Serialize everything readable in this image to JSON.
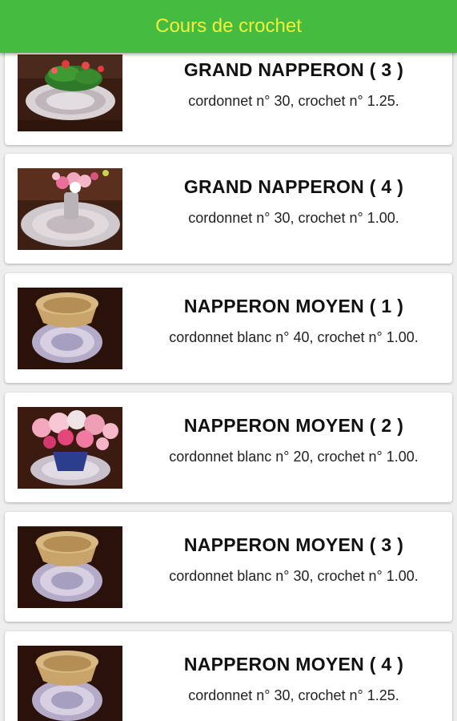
{
  "app_bar": {
    "title": "Cours de crochet",
    "background": "#45bc40",
    "title_color": "#f2ef3a"
  },
  "items": [
    {
      "title": "GRAND NAPPERON ( 3 )",
      "subtitle": "cordonnet n° 30, crochet n° 1.25.",
      "image": "doily-with-flowers-photo"
    },
    {
      "title": "GRAND NAPPERON ( 4 )",
      "subtitle": "cordonnet n° 30, crochet n° 1.00.",
      "image": "doily-with-vase-photo"
    },
    {
      "title": "NAPPERON MOYEN ( 1 )",
      "subtitle": "cordonnet blanc n° 40, crochet n° 1.00.",
      "image": "doily-with-wooden-bowl-photo"
    },
    {
      "title": "NAPPERON MOYEN ( 2 )",
      "subtitle": "cordonnet blanc n° 20, crochet n° 1.00.",
      "image": "doily-with-pink-flowers-photo"
    },
    {
      "title": "NAPPERON MOYEN ( 3 )",
      "subtitle": "cordonnet blanc n° 30, crochet n° 1.00.",
      "image": "doily-with-wooden-bowl-photo"
    },
    {
      "title": "NAPPERON MOYEN ( 4 )",
      "subtitle": "cordonnet n° 30, crochet n° 1.25.",
      "image": "doily-with-wooden-bowl-photo"
    }
  ]
}
